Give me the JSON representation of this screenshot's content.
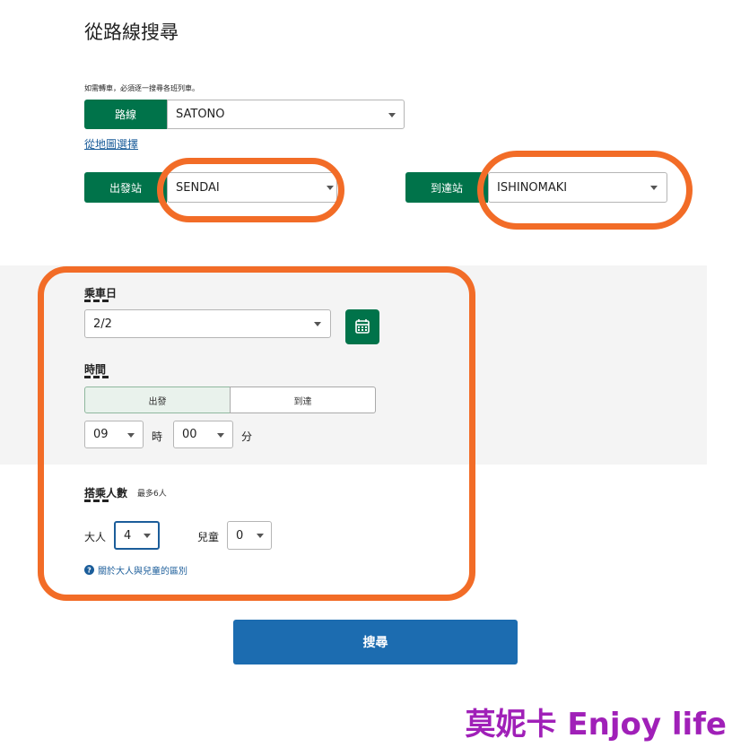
{
  "title": "從路線搜尋",
  "note": "如需轉車，必須逐一搜尋各班列車。",
  "route": {
    "label": "路線",
    "value": "SATONO",
    "map_link": "從地圖選擇"
  },
  "departure": {
    "label": "出發站",
    "value": "SENDAI"
  },
  "arrival": {
    "label": "到達站",
    "value": "ISHINOMAKI"
  },
  "date": {
    "label": "乘車日",
    "value": "2/2"
  },
  "time": {
    "label": "時間",
    "mode_depart": "出發",
    "mode_arrive": "到達",
    "hour": "09",
    "hour_unit": "時",
    "minute": "00",
    "minute_unit": "分"
  },
  "passengers": {
    "label": "搭乘人數",
    "max_note": "最多6人",
    "adult_label": "大人",
    "adult_value": "4",
    "child_label": "兒童",
    "child_value": "0",
    "help_link": "關於大人與兒童的區別"
  },
  "search_button": "搜尋",
  "watermark": "莫妮卡 Enjoy life",
  "colors": {
    "green": "#00734a",
    "orange_highlight": "#f26c27",
    "search_blue": "#1c6cb0"
  }
}
